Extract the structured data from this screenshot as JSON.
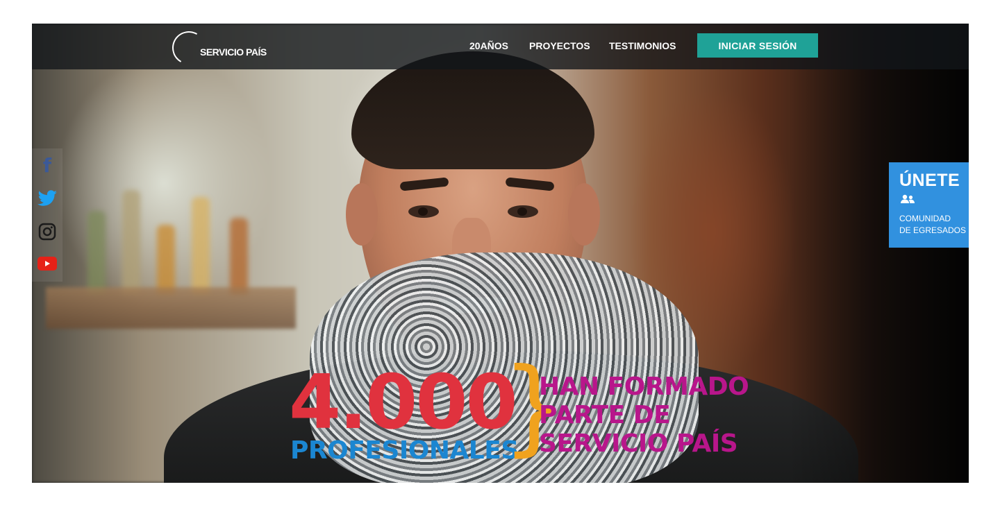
{
  "brand": {
    "logo_text": "SERVICIO PAÍS"
  },
  "nav": {
    "links": [
      {
        "label": "20AÑOS"
      },
      {
        "label": "PROYECTOS"
      },
      {
        "label": "TESTIMONIOS"
      }
    ],
    "login_label": "INICIAR SESIÓN"
  },
  "social": {
    "items": [
      {
        "icon": "facebook-icon",
        "color": "#3b5998"
      },
      {
        "icon": "twitter-icon",
        "color": "#1da1f2"
      },
      {
        "icon": "instagram-icon",
        "color": "#1a1a1a"
      },
      {
        "icon": "youtube-icon",
        "color": "#e62117"
      }
    ]
  },
  "join": {
    "title": "ÚNETE",
    "icon": "users-icon",
    "subtitle_line1": "COMUNIDAD",
    "subtitle_line2": "DE EGRESADOS",
    "color": "#3191df"
  },
  "hero": {
    "number": "4.000",
    "number_caption": "PROFESIONALES",
    "brace": "}",
    "claim_lines": [
      "HAN FORMADO",
      "PARTE DE",
      "SERVICIO PAÍS"
    ],
    "colors": {
      "number": "#e0323e",
      "caption": "#1b86d1",
      "brace": "#f0a21e",
      "claim": "#b8168b"
    }
  },
  "colors": {
    "accent": "#1fa297",
    "navbar": "#12161a"
  }
}
